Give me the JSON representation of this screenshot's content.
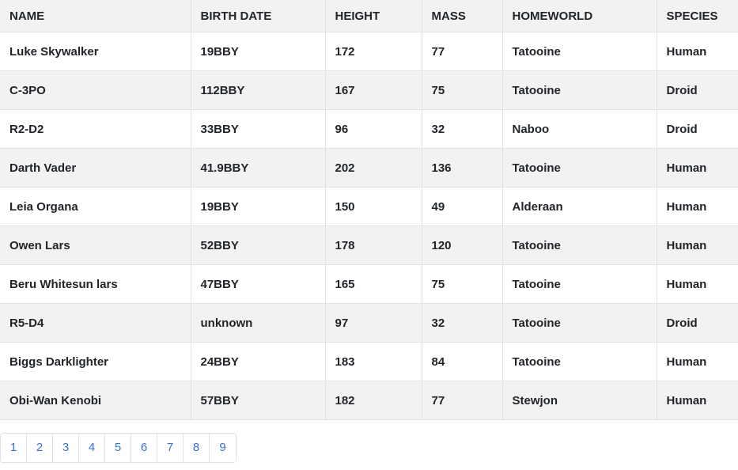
{
  "table": {
    "headers": [
      "NAME",
      "BIRTH DATE",
      "HEIGHT",
      "MASS",
      "HOMEWORLD",
      "SPECIES"
    ],
    "rows": [
      [
        "Luke Skywalker",
        "19BBY",
        "172",
        "77",
        "Tatooine",
        "Human"
      ],
      [
        "C-3PO",
        "112BBY",
        "167",
        "75",
        "Tatooine",
        "Droid"
      ],
      [
        "R2-D2",
        "33BBY",
        "96",
        "32",
        "Naboo",
        "Droid"
      ],
      [
        "Darth Vader",
        "41.9BBY",
        "202",
        "136",
        "Tatooine",
        "Human"
      ],
      [
        "Leia Organa",
        "19BBY",
        "150",
        "49",
        "Alderaan",
        "Human"
      ],
      [
        "Owen Lars",
        "52BBY",
        "178",
        "120",
        "Tatooine",
        "Human"
      ],
      [
        "Beru Whitesun lars",
        "47BBY",
        "165",
        "75",
        "Tatooine",
        "Human"
      ],
      [
        "R5-D4",
        "unknown",
        "97",
        "32",
        "Tatooine",
        "Droid"
      ],
      [
        "Biggs Darklighter",
        "24BBY",
        "183",
        "84",
        "Tatooine",
        "Human"
      ],
      [
        "Obi-Wan Kenobi",
        "57BBY",
        "182",
        "77",
        "Stewjon",
        "Human"
      ]
    ]
  },
  "pagination": {
    "pages": [
      "1",
      "2",
      "3",
      "4",
      "5",
      "6",
      "7",
      "8",
      "9"
    ]
  },
  "colors": {
    "link": "#3b6fd8",
    "stripe": "#f2f2f2",
    "border": "#dee2e6"
  }
}
